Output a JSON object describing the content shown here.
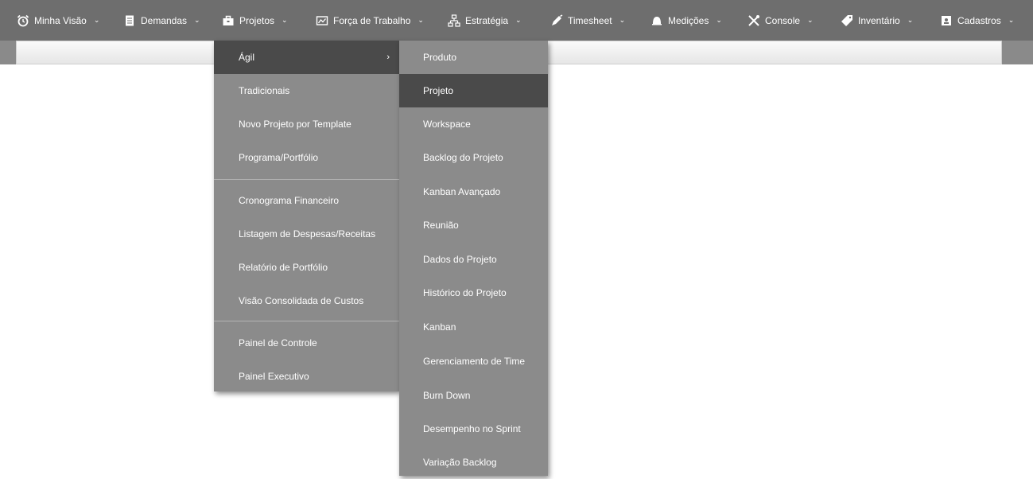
{
  "nav": {
    "items": [
      {
        "label": "Minha Visão",
        "icon": "alarm-clock-icon"
      },
      {
        "label": "Demandas",
        "icon": "document-icon"
      },
      {
        "label": "Projetos",
        "icon": "briefcase-icon"
      },
      {
        "label": "Força de Trabalho",
        "icon": "chart-window-icon"
      },
      {
        "label": "Estratégia",
        "icon": "hierarchy-icon"
      },
      {
        "label": "Timesheet",
        "icon": "pen-icon"
      },
      {
        "label": "Medições",
        "icon": "bell-icon"
      },
      {
        "label": "Console",
        "icon": "tools-icon"
      },
      {
        "label": "Inventário",
        "icon": "tag-icon"
      },
      {
        "label": "Cadastros",
        "icon": "contact-card-icon"
      }
    ],
    "chevron": "⌄"
  },
  "menu1": {
    "items": [
      {
        "label": "Ágil",
        "active": true,
        "submenu_arrow": "›"
      },
      {
        "label": "Tradicionais"
      },
      {
        "label": "Novo Projeto por Template"
      },
      {
        "label": "Programa/Portfólio"
      },
      {
        "label": "Cronograma Financeiro"
      },
      {
        "label": "Listagem de Despesas/Receitas"
      },
      {
        "label": "Relatório de Portfólio"
      },
      {
        "label": "Visão Consolidada de Custos"
      },
      {
        "label": "Painel de Controle"
      },
      {
        "label": "Painel Executivo"
      }
    ]
  },
  "menu2": {
    "items": [
      {
        "label": "Produto"
      },
      {
        "label": "Projeto",
        "active": true
      },
      {
        "label": "Workspace"
      },
      {
        "label": "Backlog do Projeto"
      },
      {
        "label": "Kanban Avançado"
      },
      {
        "label": "Reunião"
      },
      {
        "label": "Dados do Projeto"
      },
      {
        "label": "Histórico do Projeto"
      },
      {
        "label": "Kanban"
      },
      {
        "label": "Gerenciamento de Time"
      },
      {
        "label": "Burn Down"
      },
      {
        "label": "Desempenho no Sprint"
      },
      {
        "label": "Variação Backlog"
      }
    ]
  },
  "colors": {
    "navbar": "#6e6e6e",
    "menu_bg": "#8b8b8b",
    "menu_active": "#4a4a4a"
  }
}
